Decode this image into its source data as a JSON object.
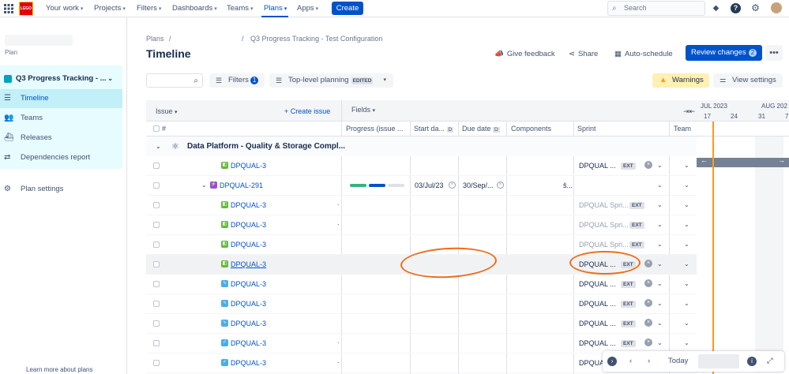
{
  "topnav": {
    "logo": "LEGO",
    "items": [
      "Your work",
      "Projects",
      "Filters",
      "Dashboards",
      "Teams",
      "Plans",
      "Apps"
    ],
    "create": "Create",
    "search_placeholder": "Search"
  },
  "sidebar": {
    "plan_label": "Plan",
    "plan_name": "Q3 Progress Tracking - ...",
    "items": [
      "Timeline",
      "Teams",
      "Releases",
      "Dependencies report"
    ],
    "settings": "Plan settings",
    "footer": "Learn more about plans"
  },
  "header": {
    "crumb_root": "Plans",
    "crumb_sep": "/",
    "crumb_sep2": "/",
    "crumb_plan": "Q3 Progress Tracking - Test Configuration",
    "title": "Timeline",
    "feedback": "Give feedback",
    "share": "Share",
    "autoschedule": "Auto-schedule",
    "review": "Review changes",
    "review_count": "2",
    "more": "•••"
  },
  "toolbar": {
    "filters": "Filters",
    "filters_count": "1",
    "toplevel": "Top-level planning",
    "edited": "EDITED",
    "warnings": "Warnings",
    "view_settings": "View settings"
  },
  "grid": {
    "issue_header": "Issue",
    "create_issue": "Create issue",
    "fields_header": "Fields",
    "hash": "#",
    "columns": [
      "Progress (issue ...",
      "Start da...",
      "Due date",
      "Components",
      "Sprint",
      "Team"
    ],
    "d_badge": "D",
    "group_name": "Data Platform - Quality & Storage Compl...",
    "months": [
      "JUL 2023",
      "AUG 202"
    ],
    "weeks": [
      "17",
      "24",
      "31",
      "7"
    ],
    "rows": [
      {
        "key": "DPQUAL-3",
        "type": "story",
        "sprint": "DPQUAL ...",
        "ext": "EXT",
        "sprint_dim": false,
        "dot": ""
      },
      {
        "key": "DPQUAL-291",
        "type": "epic",
        "sprint": "",
        "ext": "",
        "start": "03/Jul/23",
        "due": "30/Sep/...",
        "comp": "š...",
        "dot": ""
      },
      {
        "key": "DPQUAL-3",
        "type": "story",
        "sprint": "DPQUAL Spri...",
        "ext": "EXT",
        "sprint_dim": true,
        "dot": "."
      },
      {
        "key": "DPQUAL-3",
        "type": "story",
        "sprint": "DPQUAL Spri...",
        "ext": "EXT",
        "sprint_dim": true,
        "dot": "."
      },
      {
        "key": "DPQUAL-3",
        "type": "story",
        "sprint": "DPQUAL Spri...",
        "ext": "EXT",
        "sprint_dim": true,
        "dot": ""
      },
      {
        "key": "DPQUAL-3",
        "type": "story",
        "sprint": "DPQUAL ...",
        "ext": "EXT",
        "sprint_dim": false,
        "dot": "",
        "highlight": true
      },
      {
        "key": "DPQUAL-3",
        "type": "sub",
        "sprint": "DPQUAL ...",
        "ext": "EXT",
        "sprint_dim": false,
        "dot": ""
      },
      {
        "key": "DPQUAL-3",
        "type": "sub",
        "sprint": "DPQUAL ...",
        "ext": "EXT",
        "sprint_dim": false,
        "dot": ""
      },
      {
        "key": "DPQUAL-3",
        "type": "sub",
        "sprint": "DPQUAL ...",
        "ext": "EXT",
        "sprint_dim": false,
        "dot": ""
      },
      {
        "key": "DPQUAL-3",
        "type": "task",
        "sprint": "DPQUAL ...",
        "ext": "EXT",
        "sprint_dim": false,
        "dot": "."
      },
      {
        "key": "DPQUAL-3",
        "type": "task",
        "sprint": "DPQUAL ...",
        "ext": "",
        "sprint_dim": false,
        "dot": "."
      }
    ]
  },
  "zoom": {
    "today": "Today"
  },
  "colors": {
    "accent": "#0052cc",
    "today_line": "#ff991f",
    "annotation": "#ef6c1a"
  }
}
